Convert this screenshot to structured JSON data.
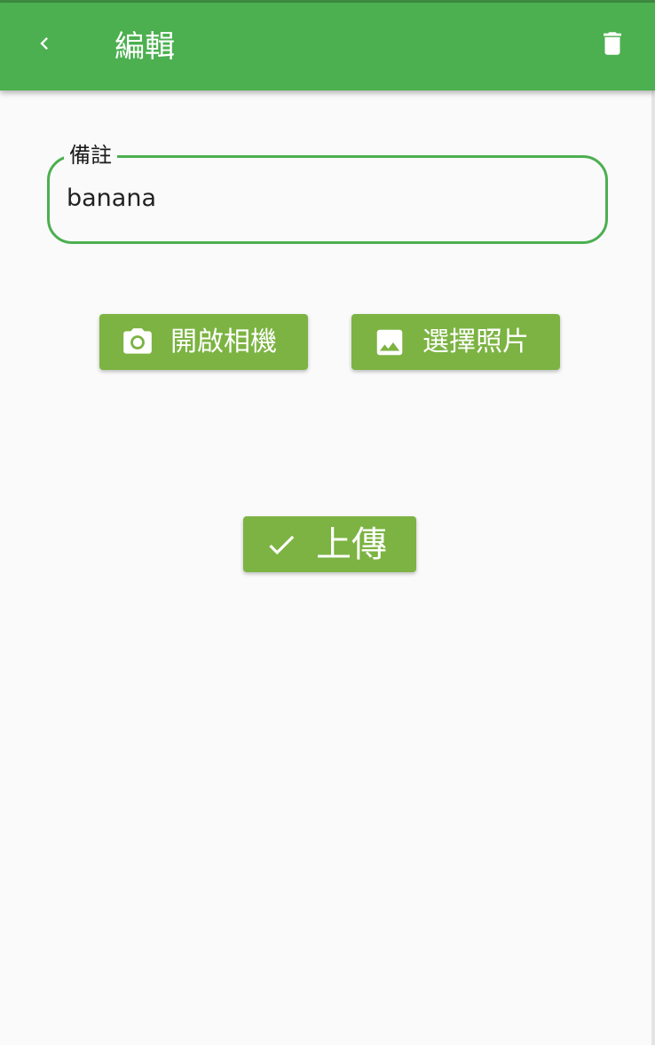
{
  "appbar": {
    "title": "編輯",
    "back_icon": "chevron-left-icon",
    "delete_icon": "trash-icon",
    "color": "#4caf50"
  },
  "form": {
    "note_label": "備註",
    "note_value": "banana"
  },
  "actions": {
    "camera_label": "開啟相機",
    "camera_icon": "camera-icon",
    "gallery_label": "選擇照片",
    "gallery_icon": "image-icon",
    "upload_label": "上傳",
    "upload_icon": "check-icon",
    "button_color": "#7cb342"
  }
}
